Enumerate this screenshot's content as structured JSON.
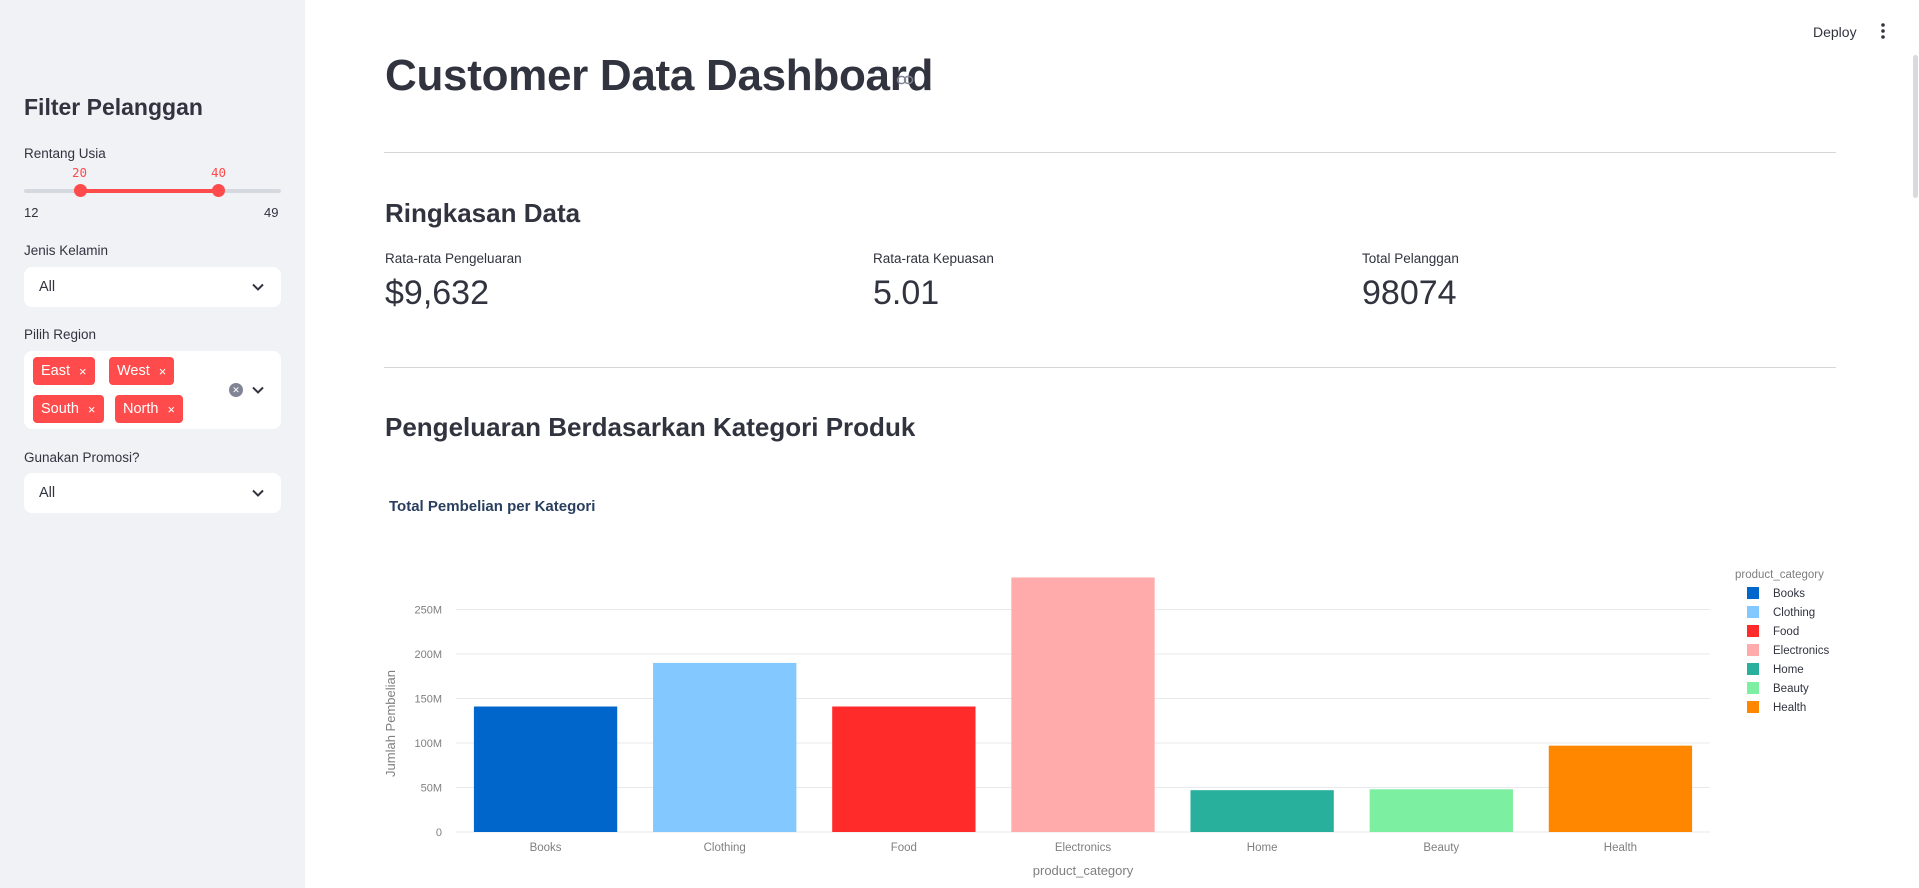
{
  "sidebar": {
    "title": "Filter Pelanggan",
    "age": {
      "label": "Rentang Usia",
      "min": 12,
      "max": 49,
      "low": 20,
      "high": 40,
      "min_label": "12",
      "max_label": "49",
      "low_label": "20",
      "high_label": "40"
    },
    "gender": {
      "label": "Jenis Kelamin",
      "value": "All"
    },
    "region": {
      "label": "Pilih Region",
      "selected": [
        "East",
        "West",
        "South",
        "North"
      ],
      "chip_remove": "×"
    },
    "promo": {
      "label": "Gunakan Promosi?",
      "value": "All"
    }
  },
  "header": {
    "deploy_label": "Deploy"
  },
  "main": {
    "title": "Customer Data Dashboard",
    "summary_heading": "Ringkasan Data",
    "metrics": [
      {
        "label": "Rata-rata Pengeluaran",
        "value": "$9,632"
      },
      {
        "label": "Rata-rata Kepuasan",
        "value": "5.01"
      },
      {
        "label": "Total Pelanggan",
        "value": "98074"
      }
    ],
    "category_heading": "Pengeluaran Berdasarkan Kategori Produk"
  },
  "colors": {
    "accent": "#ff4b4b",
    "sidebar_bg": "#f0f2f6"
  },
  "chart_data": {
    "type": "bar",
    "title": "Total Pembelian per Kategori",
    "xlabel": "product_category",
    "ylabel": "Jumlah Pembelian",
    "legend_title": "product_category",
    "legend_position": "right",
    "categories": [
      "Books",
      "Clothing",
      "Food",
      "Electronics",
      "Home",
      "Beauty",
      "Health"
    ],
    "values": [
      141000000,
      190000000,
      141000000,
      286000000,
      47000000,
      48000000,
      97000000
    ],
    "colors": [
      "#0066cc",
      "#83c9ff",
      "#ff2b2b",
      "#ffabab",
      "#29b09d",
      "#7defa1",
      "#ff8700"
    ],
    "yticks": [
      0,
      50000000,
      100000000,
      150000000,
      200000000,
      250000000
    ],
    "ytick_labels": [
      "0",
      "50M",
      "100M",
      "150M",
      "200M",
      "250M"
    ],
    "ylim": [
      0,
      300000000
    ],
    "grid": true
  }
}
